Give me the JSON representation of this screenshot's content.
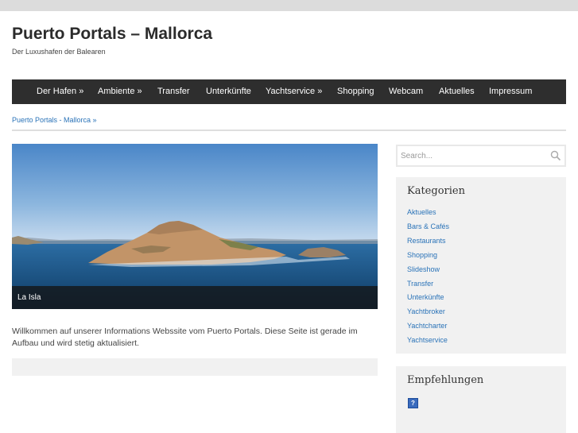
{
  "site": {
    "title": "Puerto Portals – Mallorca",
    "description": "Der Luxushafen der Balearen"
  },
  "nav": [
    {
      "label": "Der Hafen »"
    },
    {
      "label": "Ambiente »"
    },
    {
      "label": "Transfer"
    },
    {
      "label": "Unterkünfte"
    },
    {
      "label": "Yachtservice »"
    },
    {
      "label": "Shopping"
    },
    {
      "label": "Webcam"
    },
    {
      "label": "Aktuelles"
    },
    {
      "label": "Impressum"
    }
  ],
  "breadcrumb": "Puerto Portals - Mallorca »",
  "slider": {
    "caption": "La Isla"
  },
  "intro": "Willkommen auf unserer Informations Webssite vom Puerto Portals. Diese Seite ist gerade im Aufbau und wird stetig aktualisiert.",
  "search": {
    "placeholder": "Search..."
  },
  "categories": {
    "title": "Kategorien",
    "items": [
      "Aktuelles",
      "Bars & Cafés",
      "Restaurants",
      "Shopping",
      "Slideshow",
      "Transfer",
      "Unterkünfte",
      "Yachtbroker",
      "Yachtcharter",
      "Yachtservice"
    ]
  },
  "recommendations": {
    "title": "Empfehlungen",
    "icon_glyph": "?"
  },
  "colors": {
    "nav_bg": "#2e2e2e",
    "link": "#2a73b8",
    "widget_bg": "#f1f1f1"
  }
}
